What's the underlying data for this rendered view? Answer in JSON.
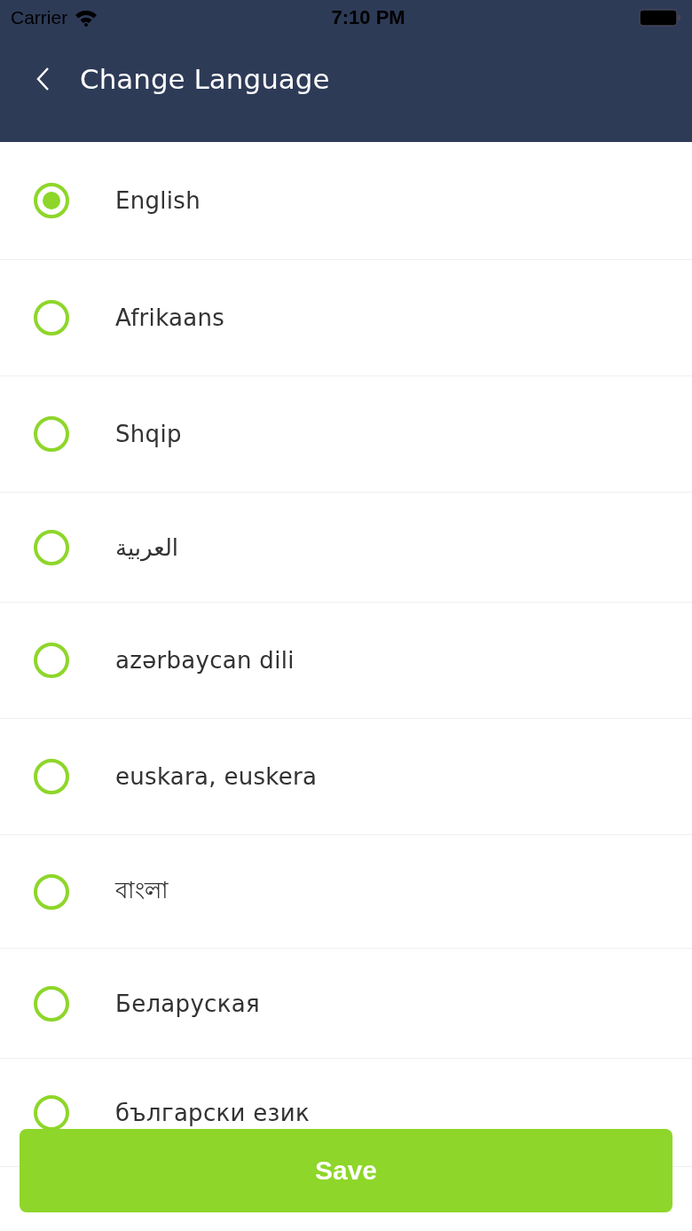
{
  "status_bar": {
    "carrier": "Carrier",
    "time": "7:10 PM"
  },
  "header": {
    "title": "Change Language"
  },
  "languages": [
    {
      "label": "English",
      "selected": true
    },
    {
      "label": "Afrikaans",
      "selected": false
    },
    {
      "label": "Shqip",
      "selected": false
    },
    {
      "label": "العربية",
      "selected": false
    },
    {
      "label": "azərbaycan dili",
      "selected": false
    },
    {
      "label": "euskara, euskera",
      "selected": false
    },
    {
      "label": "বাংলা",
      "selected": false
    },
    {
      "label": "Беларуская",
      "selected": false
    },
    {
      "label": "български език",
      "selected": false
    }
  ],
  "save_button": {
    "label": "Save"
  }
}
